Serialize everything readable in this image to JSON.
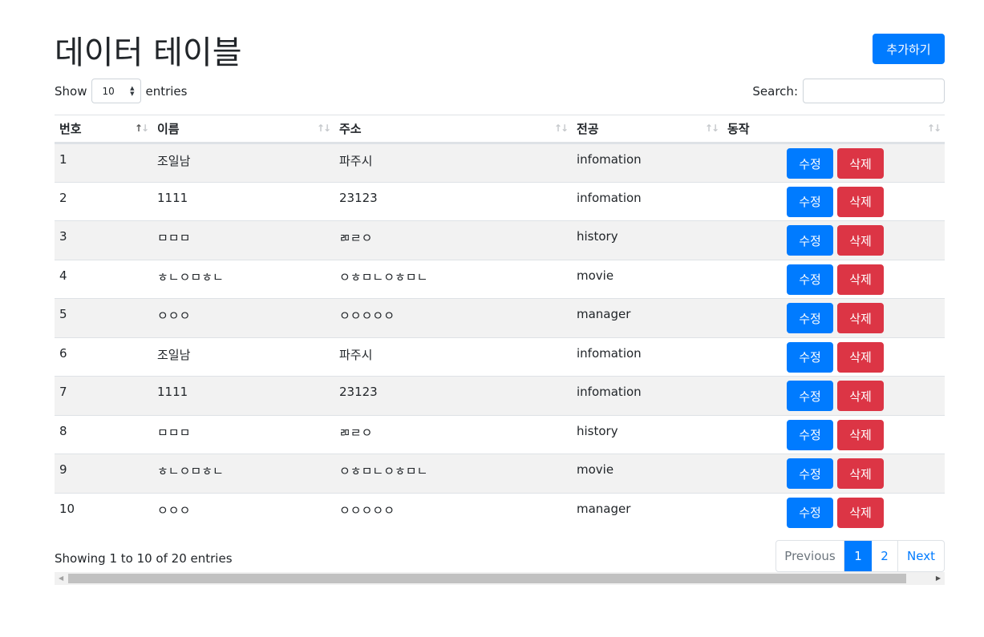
{
  "page": {
    "title": "데이터 테이블",
    "add_button": "추가하기"
  },
  "controls": {
    "show_label": "Show",
    "entries_label": "entries",
    "length_value": "10",
    "search_label": "Search:",
    "search_value": ""
  },
  "table": {
    "columns": [
      "번호",
      "이름",
      "주소",
      "전공",
      "동작"
    ],
    "edit_label": "수정",
    "delete_label": "삭제",
    "rows": [
      [
        "1",
        "조일남",
        "파주시",
        "infomation"
      ],
      [
        "2",
        "1111",
        "23123",
        "infomation"
      ],
      [
        "3",
        "ㅁㅁㅁ",
        "ㄻㄹㅇ",
        "history"
      ],
      [
        "4",
        "ㅎㄴㅇㅁㅎㄴ",
        "ㅇㅎㅁㄴㅇㅎㅁㄴ",
        "movie"
      ],
      [
        "5",
        "ㅇㅇㅇ",
        "ㅇㅇㅇㅇㅇ",
        "manager"
      ],
      [
        "6",
        "조일남",
        "파주시",
        "infomation"
      ],
      [
        "7",
        "1111",
        "23123",
        "infomation"
      ],
      [
        "8",
        "ㅁㅁㅁ",
        "ㄻㄹㅇ",
        "history"
      ],
      [
        "9",
        "ㅎㄴㅇㅁㅎㄴ",
        "ㅇㅎㅁㄴㅇㅎㅁㄴ",
        "movie"
      ],
      [
        "10",
        "ㅇㅇㅇ",
        "ㅇㅇㅇㅇㅇ",
        "manager"
      ]
    ]
  },
  "footer": {
    "info": "Showing 1 to 10 of 20 entries",
    "pagination": {
      "previous": "Previous",
      "page1": "1",
      "page2": "2",
      "next": "Next"
    }
  },
  "colors": {
    "primary": "#007bff",
    "danger": "#dc3545",
    "stripe": "#f2f2f2"
  }
}
